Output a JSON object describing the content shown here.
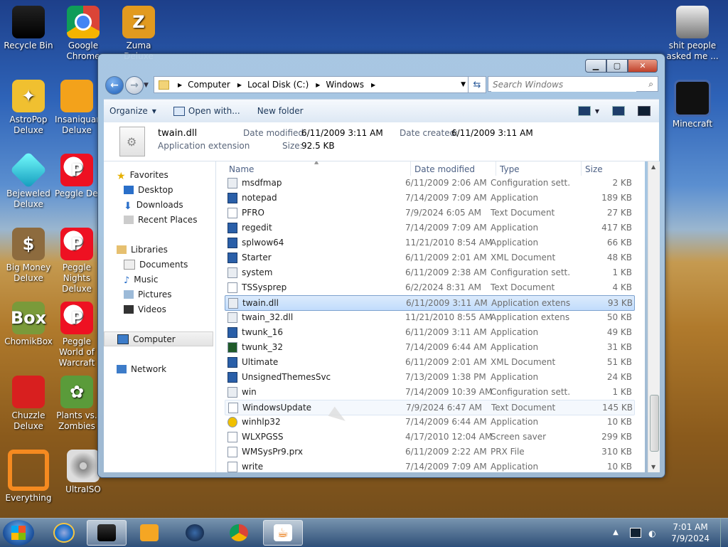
{
  "desktop": {
    "icons": [
      {
        "label": "Recycle Bin",
        "icon": "recycle-bin-icon"
      },
      {
        "label": "Google Chrome",
        "icon": "chrome-icon"
      },
      {
        "label": "Zuma Deluxe",
        "icon": "zuma-icon"
      },
      {
        "label": "AstroPop Deluxe",
        "icon": "astropop-icon"
      },
      {
        "label": "Insaniquarium Deluxe",
        "icon": "insaniquarium-icon"
      },
      {
        "label": "Bejeweled Deluxe",
        "icon": "bejeweled-icon"
      },
      {
        "label": "Peggle Deluxe",
        "icon": "peggle-icon"
      },
      {
        "label": "Big Money Deluxe",
        "icon": "big-money-icon"
      },
      {
        "label": "Peggle Nights Deluxe",
        "icon": "peggle-nights-icon"
      },
      {
        "label": "ChomikBox",
        "icon": "chomikbox-icon"
      },
      {
        "label": "Peggle World of Warcraft",
        "icon": "peggle-wow-icon"
      },
      {
        "label": "Chuzzle Deluxe",
        "icon": "chuzzle-icon"
      },
      {
        "label": "Plants vs. Zombies",
        "icon": "plants-vs-zombies-icon"
      },
      {
        "label": "Everything",
        "icon": "everything-icon"
      },
      {
        "label": "UltraISO",
        "icon": "ultraiso-icon"
      },
      {
        "label": "shit people asked me ...",
        "icon": "folder-icon"
      },
      {
        "label": "Minecraft",
        "icon": "minecraft-icon"
      }
    ]
  },
  "explorer": {
    "caption": {
      "minimize": "▁",
      "maximize": "▢",
      "close": "✕"
    },
    "breadcrumb": [
      "Computer",
      "Local Disk (C:)",
      "Windows"
    ],
    "search_placeholder": "Search Windows",
    "toolbar": {
      "organize": "Organize",
      "open_with": "Open with...",
      "new_folder": "New folder"
    },
    "details": {
      "name": "twain.dll",
      "type": "Application extension",
      "modified_label": "Date modified:",
      "modified_value": "6/11/2009 3:11 AM",
      "created_label": "Date created:",
      "created_value": "6/11/2009 3:11 AM",
      "size_label": "Size:",
      "size_value": "92.5 KB"
    },
    "nav": {
      "favorites": "Favorites",
      "desktop": "Desktop",
      "downloads": "Downloads",
      "recent": "Recent Places",
      "libraries": "Libraries",
      "documents": "Documents",
      "music": "Music",
      "pictures": "Pictures",
      "videos": "Videos",
      "computer": "Computer",
      "network": "Network"
    },
    "columns": {
      "name": "Name",
      "date": "Date modified",
      "type": "Type",
      "size": "Size"
    },
    "files": [
      {
        "name": "msdfmap",
        "date": "6/11/2009 2:06 AM",
        "type": "Configuration sett...",
        "size": "2 KB",
        "kind": "cfg"
      },
      {
        "name": "notepad",
        "date": "7/14/2009 7:09 AM",
        "type": "Application",
        "size": "189 KB",
        "kind": "app"
      },
      {
        "name": "PFRO",
        "date": "7/9/2024 6:05 AM",
        "type": "Text Document",
        "size": "27 KB",
        "kind": "txt"
      },
      {
        "name": "regedit",
        "date": "7/14/2009 7:09 AM",
        "type": "Application",
        "size": "417 KB",
        "kind": "app"
      },
      {
        "name": "splwow64",
        "date": "11/21/2010 8:54 AM",
        "type": "Application",
        "size": "66 KB",
        "kind": "app"
      },
      {
        "name": "Starter",
        "date": "6/11/2009 2:01 AM",
        "type": "XML Document",
        "size": "48 KB",
        "kind": "app"
      },
      {
        "name": "system",
        "date": "6/11/2009 2:38 AM",
        "type": "Configuration sett...",
        "size": "1 KB",
        "kind": "cfg"
      },
      {
        "name": "TSSysprep",
        "date": "6/2/2024 8:31 AM",
        "type": "Text Document",
        "size": "4 KB",
        "kind": "txt"
      },
      {
        "name": "twain.dll",
        "date": "6/11/2009 3:11 AM",
        "type": "Application extens...",
        "size": "93 KB",
        "kind": "cfg"
      },
      {
        "name": "twain_32.dll",
        "date": "11/21/2010 8:55 AM",
        "type": "Application extens...",
        "size": "50 KB",
        "kind": "cfg"
      },
      {
        "name": "twunk_16",
        "date": "6/11/2009 3:11 AM",
        "type": "Application",
        "size": "49 KB",
        "kind": "app"
      },
      {
        "name": "twunk_32",
        "date": "7/14/2009 6:44 AM",
        "type": "Application",
        "size": "31 KB",
        "kind": "green"
      },
      {
        "name": "Ultimate",
        "date": "6/11/2009 2:01 AM",
        "type": "XML Document",
        "size": "51 KB",
        "kind": "app"
      },
      {
        "name": "UnsignedThemesSvc",
        "date": "7/13/2009 1:38 PM",
        "type": "Application",
        "size": "24 KB",
        "kind": "app"
      },
      {
        "name": "win",
        "date": "7/14/2009 10:39 AM",
        "type": "Configuration sett...",
        "size": "1 KB",
        "kind": "cfg"
      },
      {
        "name": "WindowsUpdate",
        "date": "7/9/2024 6:47 AM",
        "type": "Text Document",
        "size": "145 KB",
        "kind": "txt"
      },
      {
        "name": "winhlp32",
        "date": "7/14/2009 6:44 AM",
        "type": "Application",
        "size": "10 KB",
        "kind": "help"
      },
      {
        "name": "WLXPGSS",
        "date": "4/17/2010 12:04 AM",
        "type": "Screen saver",
        "size": "299 KB",
        "kind": "txt"
      },
      {
        "name": "WMSysPr9.prx",
        "date": "6/11/2009 2:22 AM",
        "type": "PRX File",
        "size": "310 KB",
        "kind": "txt"
      },
      {
        "name": "write",
        "date": "7/14/2009 7:09 AM",
        "type": "Application",
        "size": "10 KB",
        "kind": "txt"
      }
    ],
    "selected_file": "twain.dll",
    "hovered_file": "WindowsUpdate"
  },
  "taskbar": {
    "time": "7:01 AM",
    "date": "7/9/2024"
  }
}
